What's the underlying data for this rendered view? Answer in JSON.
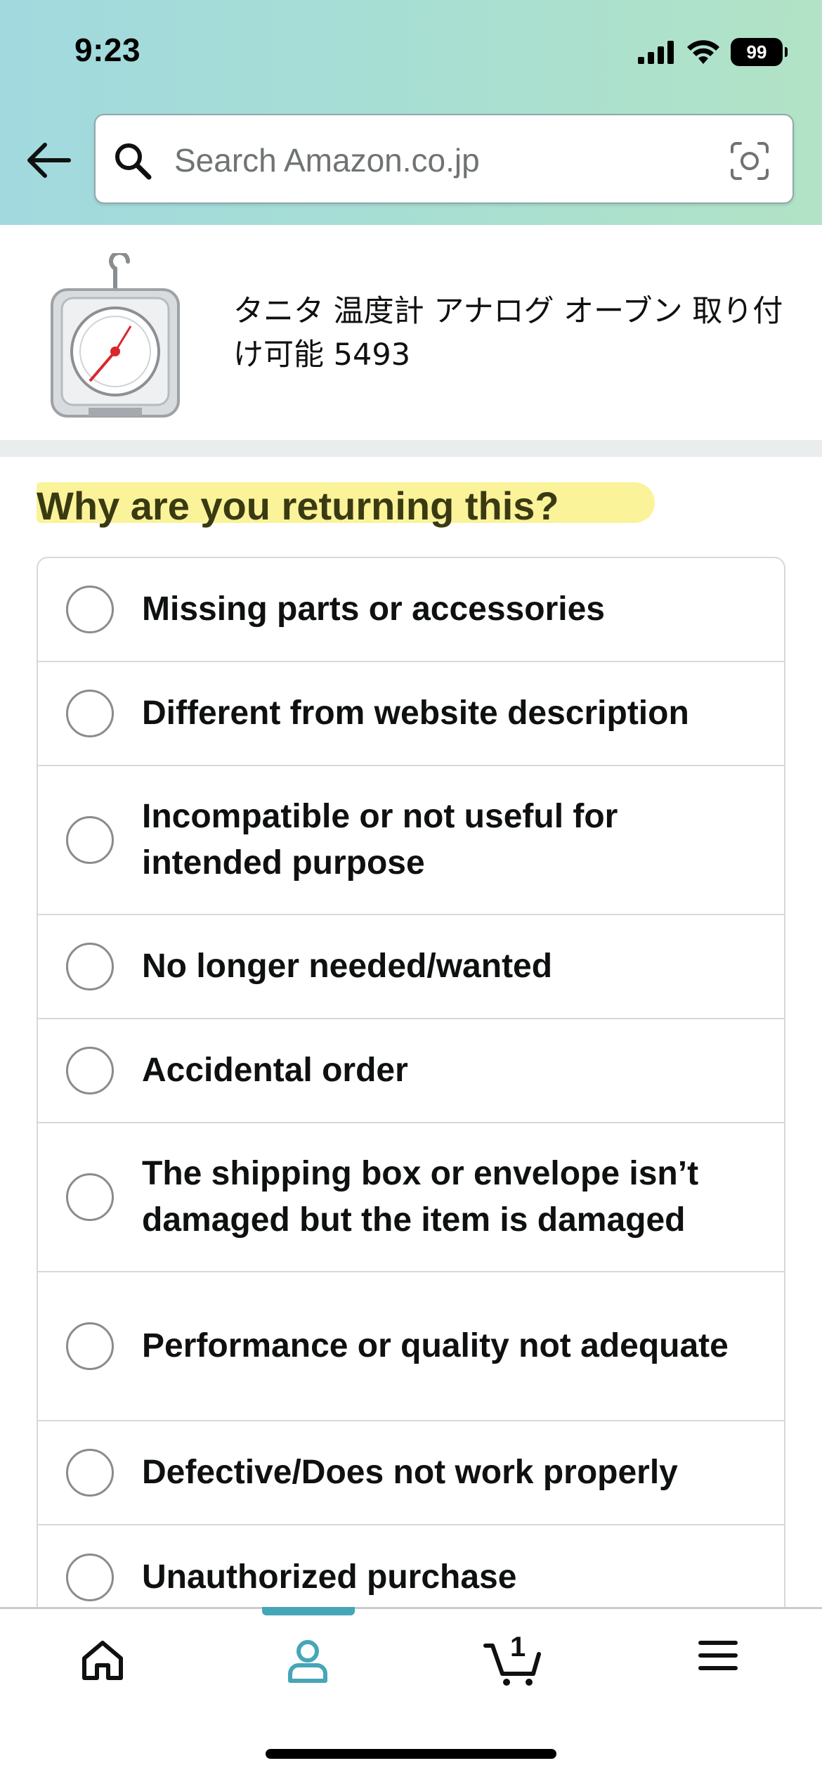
{
  "status_bar": {
    "time": "9:23",
    "battery": "99"
  },
  "header": {
    "back_icon": "arrow-left-icon",
    "search": {
      "placeholder": "Search Amazon.co.jp",
      "value": "",
      "icon": "search-icon",
      "camera_icon": "camera-scan-icon"
    }
  },
  "product": {
    "title": "タニタ 温度計 アナログ オーブン 取り付け可能 5493",
    "image_alt": "oven-thermometer-image"
  },
  "question": "Why are you returning this?",
  "reasons": [
    {
      "label": "Missing parts or accessories",
      "selected": false
    },
    {
      "label": "Different from website description",
      "selected": false
    },
    {
      "label": "Incompatible or not useful for intended purpose",
      "selected": false
    },
    {
      "label": "No longer needed/wanted",
      "selected": false
    },
    {
      "label": "Accidental order",
      "selected": false
    },
    {
      "label": "The shipping box or envelope isn’t damaged but the item is damaged",
      "selected": false
    },
    {
      "label": "Performance or quality not adequate",
      "selected": false
    },
    {
      "label": "Defective/Does not work properly",
      "selected": false
    },
    {
      "label": "Unauthorized purchase",
      "selected": false
    }
  ],
  "bottom_nav": {
    "items": [
      {
        "name": "home",
        "icon": "home-icon"
      },
      {
        "name": "account",
        "icon": "person-icon",
        "active": true
      },
      {
        "name": "cart",
        "icon": "cart-icon",
        "count": "1"
      },
      {
        "name": "menu",
        "icon": "hamburger-menu-icon"
      }
    ]
  },
  "colors": {
    "header_gradient_start": "#a1d9df",
    "header_gradient_end": "#b2e3c6",
    "highlight": "#fbf28f",
    "active_nav": "#46a6b8",
    "text": "#0f1111"
  }
}
